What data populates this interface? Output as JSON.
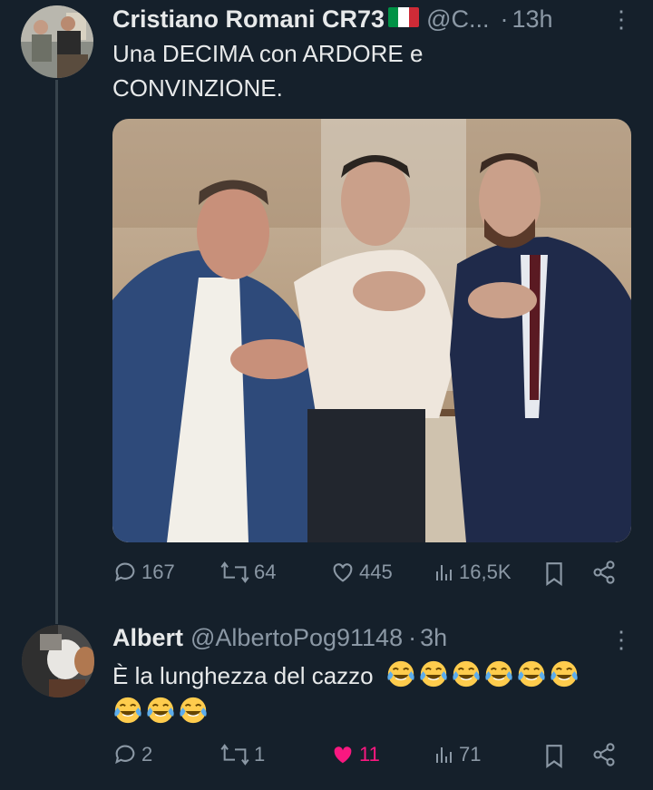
{
  "tweet": {
    "author_name": "Cristiano Romani CR73",
    "handle": "@C...",
    "separator": "·",
    "time": "13h",
    "more_symbol": "⋮",
    "text_line1": "Una DECIMA con ARDORE e",
    "text_line2": "CONVINZIONE.",
    "stats": {
      "replies": "167",
      "reposts": "64",
      "likes": "445",
      "views": "16,5K"
    }
  },
  "reply": {
    "author_name": "Albert",
    "handle": "@AlbertoPog91148",
    "separator": "·",
    "time": "3h",
    "more_symbol": "⋮",
    "text": "È la lunghezza del cazzo",
    "emoji": "😂",
    "emoji_count": 9,
    "stats": {
      "replies": "2",
      "reposts": "1",
      "likes": "11",
      "views": "71"
    }
  },
  "icons": {
    "reply": "speech-bubble-icon",
    "repost": "repost-arrows-icon",
    "like": "heart-icon",
    "views": "bar-chart-icon",
    "bookmark": "bookmark-icon",
    "share": "share-nodes-icon",
    "flag": "italy-flag-emoji"
  },
  "colors": {
    "background": "#15202b",
    "text": "#e7e9ea",
    "muted": "#8b98a5",
    "like_active": "#f91880",
    "thread_line": "#38444d"
  }
}
